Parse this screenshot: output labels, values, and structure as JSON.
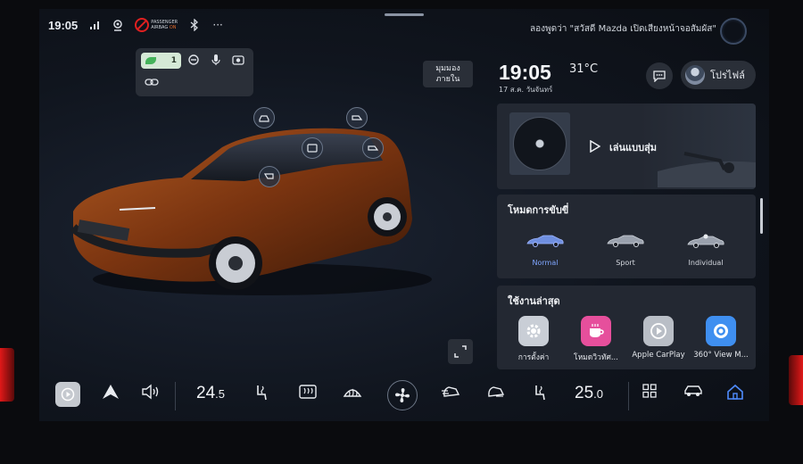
{
  "status": {
    "time": "19:05",
    "airbag_text_1": "PASSENGER",
    "airbag_text_2": "AIRBAG",
    "airbag_text_3": "ON",
    "more": "···"
  },
  "voice": {
    "hint": "ลองพูดว่า \"สวัสดี Mazda เปิดเสียงหน้าจอสัมผัส\""
  },
  "quick_panel": {
    "toggle_value": "1"
  },
  "view": {
    "inner_view_line1": "มุมมอง",
    "inner_view_line2": "ภายใน"
  },
  "header": {
    "clock": "19:05",
    "temperature": "31°C",
    "date": "17 ส.ค. วันจันทร์",
    "profile_label": "โปรไฟล์"
  },
  "media": {
    "shuffle_label": "เล่นแบบสุ่ม"
  },
  "drive_mode": {
    "title": "โหมดการขับขี่",
    "modes": [
      {
        "label": "Normal",
        "active": true
      },
      {
        "label": "Sport",
        "active": false
      },
      {
        "label": "Individual",
        "active": false
      }
    ]
  },
  "recent": {
    "title": "ใช้งานล่าสุด",
    "apps": [
      {
        "name": "การตั้งค่า",
        "icon": "settings-icon",
        "color": "#c9ced6"
      },
      {
        "name": "โหมดวิวทัศ...",
        "icon": "cup-icon",
        "color": "#e64f9c"
      },
      {
        "name": "Apple CarPlay",
        "icon": "carplay-icon",
        "color": "#b9bec6"
      },
      {
        "name": "360° View M...",
        "icon": "camera-360-icon",
        "color": "#3f8ff0"
      }
    ]
  },
  "dock": {
    "driver_temp_whole": "24",
    "driver_temp_decimal": ".5",
    "passenger_temp_whole": "25",
    "passenger_temp_decimal": ".0"
  },
  "colors": {
    "accent_blue": "#7fa6ff",
    "card_bg": "#232832",
    "car_body": "#8a3f12"
  }
}
